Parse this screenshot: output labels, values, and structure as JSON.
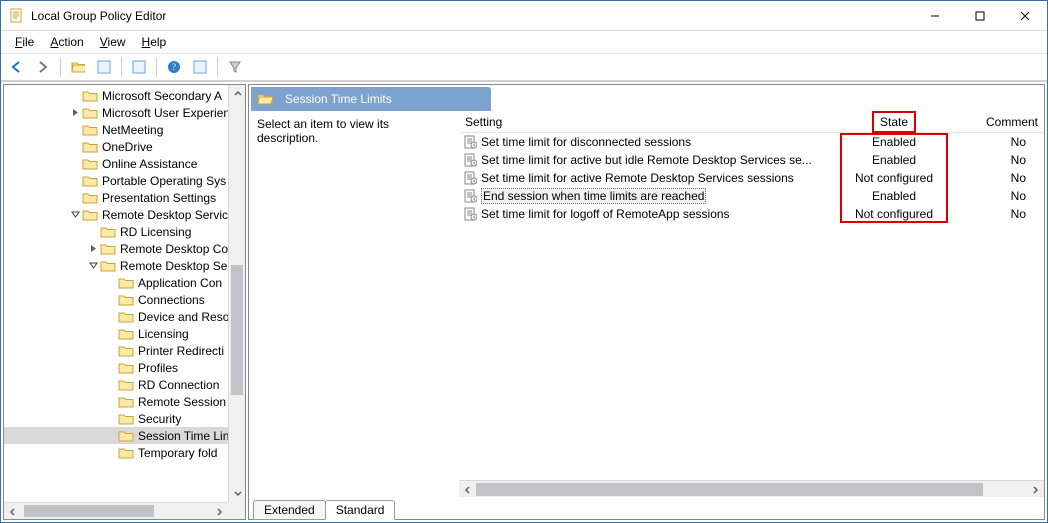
{
  "window": {
    "title": "Local Group Policy Editor"
  },
  "menubar": {
    "file": "File",
    "action": "Action",
    "view": "View",
    "help": "Help"
  },
  "panel": {
    "title": "Session Time Limits",
    "desc": "Select an item to view its description."
  },
  "columns": {
    "setting": "Setting",
    "state": "State",
    "comment": "Comment"
  },
  "tabs": {
    "extended": "Extended",
    "standard": "Standard"
  },
  "rows": [
    {
      "label": "Set time limit for disconnected sessions",
      "state": "Enabled",
      "comment": "No"
    },
    {
      "label": "Set time limit for active but idle Remote Desktop Services se...",
      "state": "Enabled",
      "comment": "No"
    },
    {
      "label": "Set time limit for active Remote Desktop Services sessions",
      "state": "Not configured",
      "comment": "No"
    },
    {
      "label": "End session when time limits are reached",
      "state": "Enabled",
      "comment": "No",
      "selected": true
    },
    {
      "label": "Set time limit for logoff of RemoteApp sessions",
      "state": "Not configured",
      "comment": "No"
    }
  ],
  "tree": [
    {
      "indent": 78,
      "exp": "",
      "label": "Microsoft Secondary A"
    },
    {
      "indent": 78,
      "exp": ">",
      "label": "Microsoft User Experien"
    },
    {
      "indent": 78,
      "exp": "",
      "label": "NetMeeting"
    },
    {
      "indent": 78,
      "exp": "",
      "label": "OneDrive"
    },
    {
      "indent": 78,
      "exp": "",
      "label": "Online Assistance"
    },
    {
      "indent": 78,
      "exp": "",
      "label": "Portable Operating Sys"
    },
    {
      "indent": 78,
      "exp": "",
      "label": "Presentation Settings"
    },
    {
      "indent": 78,
      "exp": "v",
      "label": "Remote Desktop Service"
    },
    {
      "indent": 96,
      "exp": "",
      "label": "RD Licensing"
    },
    {
      "indent": 96,
      "exp": ">",
      "label": "Remote Desktop Co"
    },
    {
      "indent": 96,
      "exp": "v",
      "label": "Remote Desktop Se"
    },
    {
      "indent": 114,
      "exp": "",
      "label": "Application Con"
    },
    {
      "indent": 114,
      "exp": "",
      "label": "Connections"
    },
    {
      "indent": 114,
      "exp": "",
      "label": "Device and Reso"
    },
    {
      "indent": 114,
      "exp": "",
      "label": "Licensing"
    },
    {
      "indent": 114,
      "exp": "",
      "label": "Printer Redirecti"
    },
    {
      "indent": 114,
      "exp": "",
      "label": "Profiles"
    },
    {
      "indent": 114,
      "exp": "",
      "label": "RD Connection"
    },
    {
      "indent": 114,
      "exp": "",
      "label": "Remote Session"
    },
    {
      "indent": 114,
      "exp": "",
      "label": "Security"
    },
    {
      "indent": 114,
      "exp": "",
      "label": "Session Time Lin",
      "selected": true
    },
    {
      "indent": 114,
      "exp": "",
      "label": "Temporary fold"
    }
  ]
}
